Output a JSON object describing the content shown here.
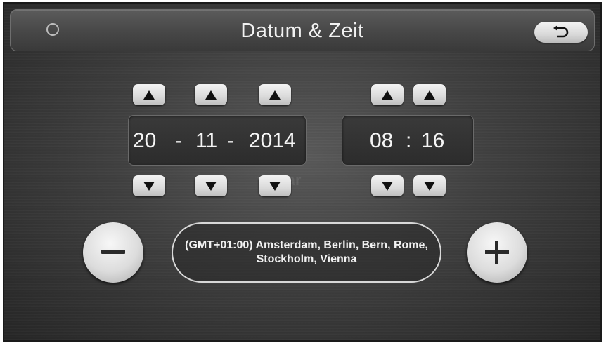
{
  "header": {
    "title": "Datum & Zeit",
    "status_icon": "circle-icon",
    "back_icon": "return-arrow-icon"
  },
  "date": {
    "day": "20",
    "month": "11",
    "year": "2014",
    "separator": "-"
  },
  "time": {
    "hour": "08",
    "minute": "16",
    "separator": ":"
  },
  "watermark": "vGear",
  "timezone": {
    "label": "(GMT+01:00) Amsterdam, Berlin, Bern, Rome, Stockholm, Vienna"
  },
  "controls": {
    "decrease_icon": "minus-icon",
    "increase_icon": "plus-icon",
    "up_icon": "triangle-up-icon",
    "down_icon": "triangle-down-icon"
  }
}
